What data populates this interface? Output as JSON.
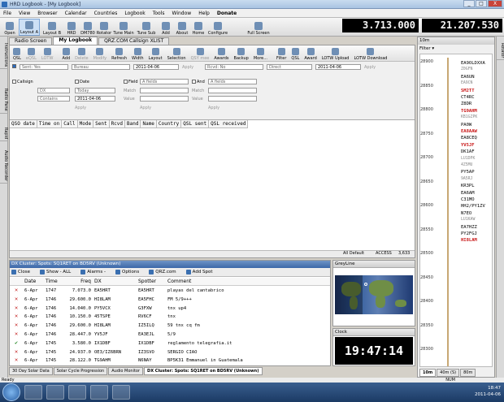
{
  "window": {
    "title": "HRD Logbook - [My Logbook]",
    "min": "_",
    "max": "□",
    "close": "X"
  },
  "menu": [
    "File",
    "View",
    "Browser",
    "Calendar",
    "Countries",
    "Logbook",
    "Tools",
    "Window",
    "Help",
    "Donate"
  ],
  "toolbar": [
    {
      "label": "Open",
      "icon": "folder-icon"
    },
    {
      "label": "Layout A",
      "icon": "layout-icon",
      "selected": true
    },
    {
      "label": "Layout B",
      "icon": "layout-icon"
    },
    {
      "label": "HRD",
      "icon": "radio-icon"
    },
    {
      "label": "DM780",
      "icon": "digital-icon"
    },
    {
      "label": "Rotator",
      "icon": "rotator-icon"
    },
    {
      "label": "Tune Main",
      "icon": "tune-icon"
    },
    {
      "label": "Tune Sub",
      "icon": "tune-icon"
    },
    {
      "label": "Add",
      "icon": "add-icon"
    },
    {
      "label": "About",
      "icon": "info-icon"
    },
    {
      "label": "Home",
      "icon": "home-icon"
    },
    {
      "label": "Configure",
      "icon": "gear-icon"
    },
    {
      "label": "Full Screen",
      "icon": "fullscreen-icon"
    }
  ],
  "freq_main": "3.713.000",
  "freq_sub": "21.207.530",
  "left_tabs": [
    "Instructions",
    "Radio Pane",
    "Rapid",
    "Audio Recorder"
  ],
  "right_tabs": [
    "Rotator"
  ],
  "tabs": [
    "Radio Screen",
    "My Logbook",
    "QRZ.COM Callsign XLIST"
  ],
  "log_toolbar": [
    "QSL",
    "eQSL",
    "LOTW",
    "Add",
    "Delete",
    "Modify",
    "Refresh",
    "Width",
    "Layout",
    "Selection",
    "QSY mee",
    "Awards",
    "Backup",
    "More...",
    "Filter",
    "QSL",
    "Award",
    "LOTW Upload",
    "LOTW Download"
  ],
  "filters": {
    "sent_label": "Sent: Yes",
    "bureau": "Bureau",
    "date_from": "2011-04-06",
    "recvd_label": "Rcvd: No",
    "direct": "Direct",
    "date_to": "2011-04-06",
    "apply": "Apply",
    "callsign": "Callsign",
    "date": "Date",
    "field": "Field",
    "and": "And",
    "call_value": "DX",
    "today": "Today",
    "field_a": "A fields",
    "field_b": "A fields",
    "rows": "Contains",
    "date_value": "2011-04-06",
    "match": "Match",
    "value": "Value"
  },
  "log_columns": [
    "QSO date",
    "Time on",
    "Call",
    "Mode",
    "Sent",
    "Rcvd",
    "Band",
    "Name",
    "Country",
    "QSL sent",
    "QSL received"
  ],
  "log_status": {
    "left": "All Default",
    "db": "ACCESS",
    "count": "3,633"
  },
  "dx": {
    "title": "DX Cluster: Spots: SQ1RET on BD5RV (Unknown)",
    "toolbar": [
      "Close",
      "Show - ALL",
      "Alarms -",
      "Options",
      "QRZ.com",
      "Add Spot"
    ],
    "columns": [
      "Date",
      "Time",
      "Freq",
      "DX",
      "Spotter",
      "Comment"
    ],
    "rows": [
      {
        "icon": "x",
        "date": "6-Apr",
        "time": "1747",
        "freq": "7.073.0",
        "dx": "EA5HRT",
        "spotter": "EA5HRT",
        "comment": "playas del cantabrico"
      },
      {
        "icon": "x",
        "date": "6-Apr",
        "time": "1746",
        "freq": "29.600.0",
        "dx": "HI8LAM",
        "spotter": "EA5FHC",
        "comment": "FM 5/9+++"
      },
      {
        "icon": "x",
        "date": "6-Apr",
        "time": "1746",
        "freq": "14.040.0",
        "dx": "PY5VCX",
        "spotter": "G3FXW",
        "comment": "tnx up4"
      },
      {
        "icon": "x",
        "date": "6-Apr",
        "time": "1746",
        "freq": "10.150.0",
        "dx": "45TSPE",
        "spotter": "RV6CF",
        "comment": "tnx"
      },
      {
        "icon": "x",
        "date": "6-Apr",
        "time": "1746",
        "freq": "29.600.0",
        "dx": "HI8LAM",
        "spotter": "IZ5ILQ",
        "comment": "59 tnx cq fm"
      },
      {
        "icon": "x",
        "date": "6-Apr",
        "time": "1746",
        "freq": "28.447.0",
        "dx": "YV5JF",
        "spotter": "EA3EJL",
        "comment": "5/9"
      },
      {
        "icon": "check",
        "date": "6-Apr",
        "time": "1745",
        "freq": "3.580.0",
        "dx": "IX1DBF",
        "spotter": "IX1DBF",
        "comment": "reglamento telegrafia.it"
      },
      {
        "icon": "x",
        "date": "6-Apr",
        "time": "1745",
        "freq": "24.937.0",
        "dx": "OE3/IZ6BRN",
        "spotter": "IZ3SVO",
        "comment": "SERGIO CIAO"
      },
      {
        "icon": "x",
        "date": "6-Apr",
        "time": "1745",
        "freq": "28.122.0",
        "dx": "TG9AHM",
        "spotter": "N6NAY",
        "comment": "BP5K31 Emmanuel in Guatemala"
      }
    ]
  },
  "greyline_title": "GreyLine",
  "clock_title": "Clock",
  "clock": "19:47:14",
  "bottom_tabs": [
    "30 Day Solar Data",
    "Solar Cycle Progression",
    "Audio Monitor",
    "DX Cluster: Spots: SQ1RET on BD5RV (Unknown)"
  ],
  "bandmap": {
    "title": "10m",
    "filter": "Filter",
    "ticks": [
      "28900",
      "28850",
      "28800",
      "28750",
      "28700",
      "28650",
      "28600",
      "28550",
      "28500",
      "28450",
      "28400",
      "28350",
      "28300"
    ],
    "spots": [
      {
        "call": "EA9OLDXXA",
        "style": ""
      },
      {
        "call": "Z0GFN",
        "style": "gy"
      },
      {
        "call": "EA6UN",
        "style": ""
      },
      {
        "call": "EA9CN",
        "style": "gy"
      },
      {
        "call": "SM2TT",
        "style": "rd"
      },
      {
        "call": "CT4RC",
        "style": ""
      },
      {
        "call": "Z8DR",
        "style": ""
      },
      {
        "call": "TG9AHM",
        "style": "rd"
      },
      {
        "call": "KB1GZPK",
        "style": "gy"
      },
      {
        "call": "PA0W",
        "style": ""
      },
      {
        "call": "EA8AAW",
        "style": "rd"
      },
      {
        "call": "EA8CEQ",
        "style": ""
      },
      {
        "call": "YV5JF",
        "style": "rd"
      },
      {
        "call": "DK1AF",
        "style": ""
      },
      {
        "call": "LU1DPK",
        "style": "gy"
      },
      {
        "call": "4Z5MU",
        "style": "gy"
      },
      {
        "call": "PY5AP",
        "style": ""
      },
      {
        "call": "9A5RJ",
        "style": "gy"
      },
      {
        "call": "KR3PL",
        "style": ""
      },
      {
        "call": "EA6AM",
        "style": ""
      },
      {
        "call": "C31MO",
        "style": ""
      },
      {
        "call": "HH2/PY1ZV",
        "style": ""
      },
      {
        "call": "N7EO",
        "style": ""
      },
      {
        "call": "LU1KAW",
        "style": "gy"
      },
      {
        "call": "EA7HZZ",
        "style": ""
      },
      {
        "call": "PY2FGJ",
        "style": ""
      },
      {
        "call": "HI8LAM",
        "style": "rd"
      }
    ],
    "buttons": [
      "10m",
      "40m (S)",
      "80m"
    ]
  },
  "status": {
    "left": "Ready",
    "right": "NUM"
  },
  "tray": {
    "time": "18:47",
    "date": "2011-04-06"
  }
}
